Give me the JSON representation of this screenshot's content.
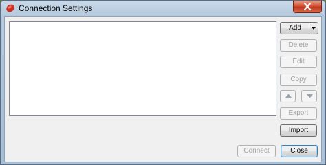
{
  "window": {
    "title": "Connection Settings"
  },
  "buttons": {
    "add": "Add",
    "delete": "Delete",
    "edit": "Edit",
    "copy": "Copy",
    "export": "Export",
    "import": "Import",
    "connect": "Connect",
    "close": "Close"
  },
  "icons": {
    "app": "red-leaf-icon",
    "move_up": "triangle-up-icon",
    "move_down": "triangle-down-icon",
    "add_dropdown": "chevron-down-icon",
    "window_close": "close-icon"
  },
  "colors": {
    "title_bar": "#b4c9dd",
    "close_button": "#c0391c",
    "client_bg": "#f0f0f0",
    "disabled_text": "#a0a0a0"
  },
  "connection_list": {
    "items": []
  }
}
